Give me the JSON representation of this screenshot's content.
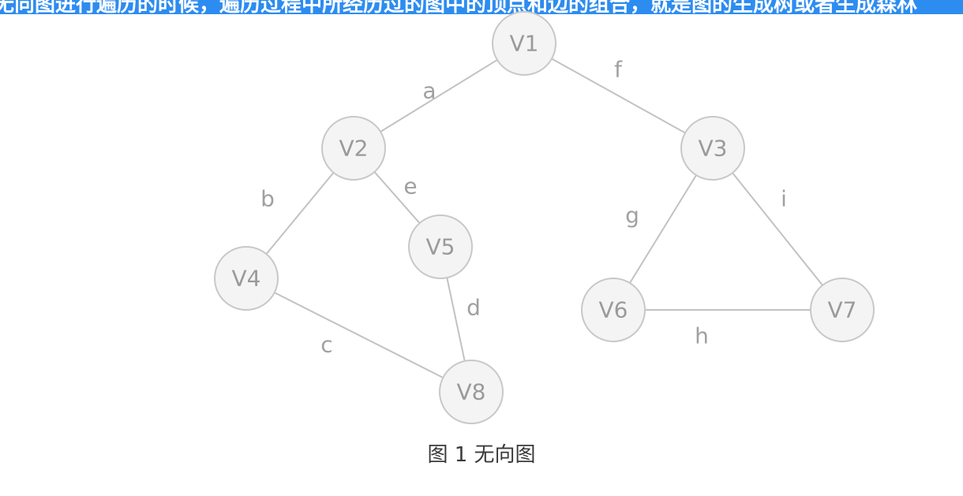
{
  "banner": {
    "text": "无向图进行遍历的时候，遍历过程中所经历过的图中的顶点和边的组合，就是图的生成树或者生成森林",
    "color": "#2d8cf0"
  },
  "graph": {
    "nodes": [
      {
        "id": "V1",
        "label": "V1"
      },
      {
        "id": "V2",
        "label": "V2"
      },
      {
        "id": "V3",
        "label": "V3"
      },
      {
        "id": "V4",
        "label": "V4"
      },
      {
        "id": "V5",
        "label": "V5"
      },
      {
        "id": "V6",
        "label": "V6"
      },
      {
        "id": "V7",
        "label": "V7"
      },
      {
        "id": "V8",
        "label": "V8"
      }
    ],
    "edges": [
      {
        "from": "V1",
        "to": "V2",
        "label": "a"
      },
      {
        "from": "V2",
        "to": "V4",
        "label": "b"
      },
      {
        "from": "V4",
        "to": "V8",
        "label": "c"
      },
      {
        "from": "V5",
        "to": "V8",
        "label": "d"
      },
      {
        "from": "V2",
        "to": "V5",
        "label": "e"
      },
      {
        "from": "V1",
        "to": "V3",
        "label": "f"
      },
      {
        "from": "V3",
        "to": "V6",
        "label": "g"
      },
      {
        "from": "V6",
        "to": "V7",
        "label": "h"
      },
      {
        "from": "V3",
        "to": "V7",
        "label": "i"
      }
    ]
  },
  "caption": "图 1 无向图"
}
